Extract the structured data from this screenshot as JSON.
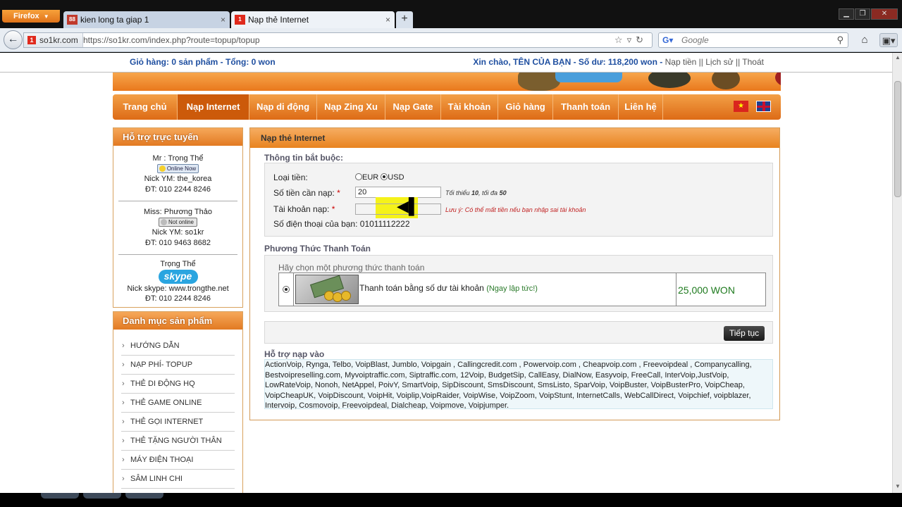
{
  "browser": {
    "menu_label": "Firefox",
    "tabs": [
      {
        "title": "kien long ta giap 1",
        "favicon_text": "88",
        "favicon_color": "#c0392b",
        "active": false
      },
      {
        "title": "Nạp thẻ Internet",
        "favicon_text": "1",
        "favicon_color": "#e02a1d",
        "active": true
      }
    ],
    "site_identity": "so1kr.com",
    "url": "https://so1kr.com/index.php?route=topup/topup",
    "search_engine": "Google",
    "search_placeholder": "Google"
  },
  "topinfo": {
    "cart": "Giỏ hàng: 0 sản phẩm - Tổng: 0 won",
    "greeting": "Xin chào, TÊN CỦA BẠN - Số dư: 118,200 won",
    "sep1": " - ",
    "links": "Nạp tiền || Lịch sử || Thoát"
  },
  "nav": {
    "items": [
      {
        "label": "Trang chủ",
        "active": false
      },
      {
        "label": "Nạp Internet",
        "active": true
      },
      {
        "label": "Nạp di động",
        "active": false
      },
      {
        "label": "Nạp Zing Xu",
        "active": false
      },
      {
        "label": "Nạp Gate",
        "active": false
      },
      {
        "label": "Tài khoản",
        "active": false
      },
      {
        "label": "Giỏ hàng",
        "active": false
      },
      {
        "label": "Thanh toán",
        "active": false
      },
      {
        "label": "Liên hệ",
        "active": false
      }
    ],
    "flag_vn": "★"
  },
  "support": {
    "title": "Hỗ trợ trực tuyến",
    "contacts": [
      {
        "name": "Mr : Trọng Thể",
        "status": "Online Now",
        "nick": "Nick YM: the_korea",
        "phone": "ĐT: 010 2244 8246"
      },
      {
        "name": "Miss: Phương Thảo",
        "status": "Not online",
        "nick": "Nick YM: so1kr",
        "phone": "ĐT: 010 9463 8682"
      },
      {
        "name": "Trọng Thể",
        "status": "skype",
        "nick": "Nick skype: www.trongthe.net",
        "phone": "ĐT: 010 2244 8246"
      }
    ]
  },
  "catalog": {
    "title": "Danh mục sản phẩm",
    "items": [
      "HƯỚNG DẪN",
      "NẠP PHÍ- TOPUP",
      "THẺ DI ĐỘNG HQ",
      "THẺ GAME ONLINE",
      "THẺ GỌI INTERNET",
      "THẺ TẶNG NGƯỜI THÂN",
      "MÁY ĐIỆN THOẠI",
      "SÂM LINH CHI"
    ]
  },
  "panel": {
    "title": "Nạp thẻ Internet",
    "required_title": "Thông tin bắt buộc:",
    "currency_label": "Loại tiền:",
    "currency_opt1": "EUR",
    "currency_opt2": "USD",
    "amount_label": "Số tiền cần nạp:",
    "amount_value": "20",
    "amount_hint_pre": "Tối thiểu ",
    "amount_hint_min": "10",
    "amount_hint_mid": ", tối đa ",
    "amount_hint_max": "50",
    "account_label": "Tài khoản nạp:",
    "account_value": "",
    "account_warning": "Lưu ý: Có thể mất tiền nếu bạn nhập sai tài khoản",
    "phone_label": "Số điện thoại của bạn:",
    "phone_value": "01011112222",
    "required_mark": "*",
    "payment_title": "Phương Thức Thanh Toán",
    "payment_prompt": "Hãy chọn một phương thức thanh toán",
    "payment_option": "Thanh toán bằng số dư tài khoản",
    "payment_option_note": "(Ngay lập tức!)",
    "payment_amount": "25,000 WON",
    "continue_button": "Tiếp tục",
    "providers_title": "Hỗ trợ nạp vào",
    "providers_text": "ActionVoip, Rynga, Telbo, VoipBlast, Jumblo, Voipgain , Callingcredit.com , Powervoip.com , Cheapvoip.com , Freevoipdeal , Companycalling, Bestvoipreselling.com, Myvoiptraffic.com, Siptraffic.com, 12Voip, BudgetSip, CallEasy, DialNow, Easyvoip, FreeCall, InterVoip,JustVoip, LowRateVoip, Nonoh, NetAppel, PoivY, SmartVoip, SipDiscount, SmsDiscount, SmsListo, SparVoip, VoipBuster, VoipBusterPro, VoipCheap, VoipCheapUK, VoipDiscount, VoipHit, Voiplip,VoipRaider, VoipWise, VoipZoom, VoipStunt, InternetCalls, WebCallDirect, Voipchief, voipblazer, Intervoip, Cosmovoip, Freevoipdeal, Dialcheap, Voipmove, Voipjumper."
  }
}
